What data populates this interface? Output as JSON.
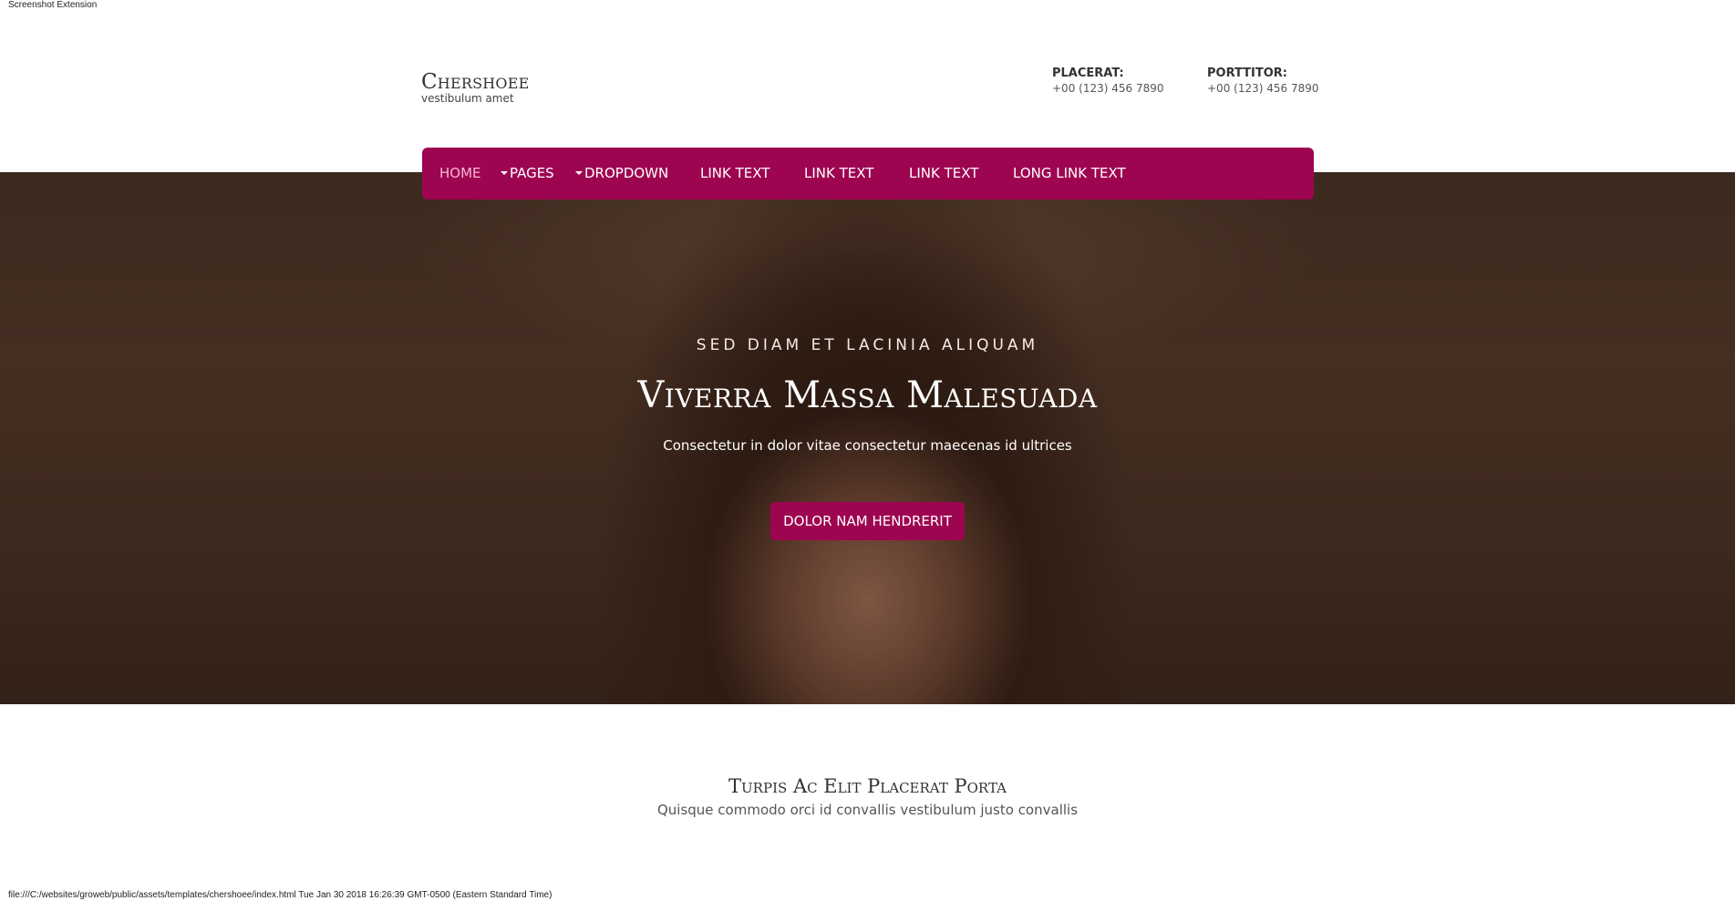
{
  "browser": {
    "extension_label": "Screenshot Extension",
    "footer_path": "file:///C:/websites/groweb/public/assets/templates/chershoee/index.html Tue Jan 30 2018 16:26:39 GMT-0500 (Eastern Standard Time)"
  },
  "brand": {
    "name": "Chershoee",
    "tagline": "vestibulum amet"
  },
  "contacts": [
    {
      "label": "PLACERAT:",
      "phone": "+00 (123) 456 7890"
    },
    {
      "label": "PORTTITOR:",
      "phone": "+00 (123) 456 7890"
    }
  ],
  "nav": {
    "items": [
      {
        "label": "HOME",
        "active": true
      },
      {
        "label": "PAGES",
        "dropdown": true
      },
      {
        "label": "DROPDOWN",
        "dropdown": true
      },
      {
        "label": "LINK TEXT"
      },
      {
        "label": "LINK TEXT"
      },
      {
        "label": "LINK TEXT"
      },
      {
        "label": "LONG LINK TEXT"
      }
    ]
  },
  "hero": {
    "eyebrow": "SED DIAM ET LACINIA ALIQUAM",
    "title": "Viverra Massa Malesuada",
    "subtitle": "Consectetur in dolor vitae consectetur maecenas id ultrices",
    "button_label": "DOLOR NAM HENDRERIT"
  },
  "section": {
    "title": "Turpis Ac Elit Placerat Porta",
    "subtitle": "Quisque commodo orci id convallis vestibulum justo convallis"
  },
  "colors": {
    "accent": "#9e0551",
    "active_nav": "#f7b7d0"
  }
}
